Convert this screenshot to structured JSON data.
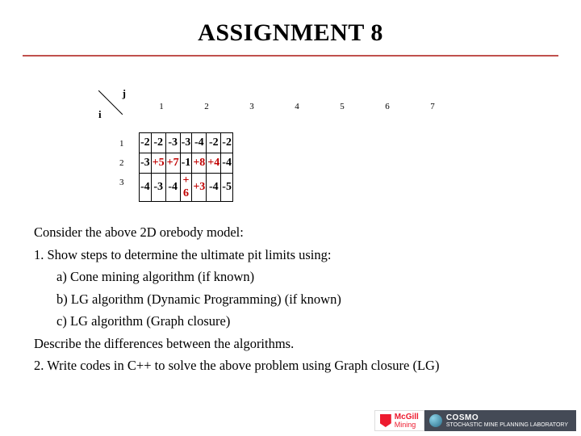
{
  "title": "ASSIGNMENT 8",
  "axes": {
    "row_label": "i",
    "col_label": "j"
  },
  "chart_data": {
    "type": "table",
    "col_headers": [
      "1",
      "2",
      "3",
      "4",
      "5",
      "6",
      "7"
    ],
    "row_headers": [
      "1",
      "2",
      "3"
    ],
    "cells": [
      [
        {
          "v": "-2",
          "s": "neg"
        },
        {
          "v": "-2",
          "s": "neg"
        },
        {
          "v": "-3",
          "s": "neg"
        },
        {
          "v": "-3",
          "s": "neg"
        },
        {
          "v": "-4",
          "s": "neg"
        },
        {
          "v": "-2",
          "s": "neg"
        },
        {
          "v": "-2",
          "s": "neg"
        }
      ],
      [
        {
          "v": "-3",
          "s": "neg"
        },
        {
          "v": "+5",
          "s": "pos"
        },
        {
          "v": "+7",
          "s": "pos"
        },
        {
          "v": "-1",
          "s": "neg"
        },
        {
          "v": "+8",
          "s": "pos"
        },
        {
          "v": "+4",
          "s": "pos"
        },
        {
          "v": "-4",
          "s": "neg"
        }
      ],
      [
        {
          "v": "-4",
          "s": "neg"
        },
        {
          "v": "-3",
          "s": "neg"
        },
        {
          "v": "-4",
          "s": "neg"
        },
        {
          "v": "+ 6",
          "s": "pos"
        },
        {
          "v": "+3",
          "s": "pos"
        },
        {
          "v": "-4",
          "s": "neg"
        },
        {
          "v": "-5",
          "s": "neg"
        }
      ]
    ]
  },
  "body": {
    "p1": "Consider the above 2D orebody model:",
    "p2": "1. Show steps  to determine the ultimate pit limits using:",
    "p2a": "a) Cone mining algorithm  (if known)",
    "p2b": "b) LG algorithm (Dynamic Programming) (if known)",
    "p2c": "c) LG algorithm (Graph closure)",
    "p3": "Describe the differences between the algorithms.",
    "p4": "2. Write codes in C++ to solve the above problem using Graph closure (LG)"
  },
  "footer": {
    "mcgill_main": "McGill",
    "mcgill_sub": "Mining",
    "cosmo_main": "COSMO",
    "cosmo_sub": "STOCHASTIC MINE PLANNING LABORATORY"
  }
}
